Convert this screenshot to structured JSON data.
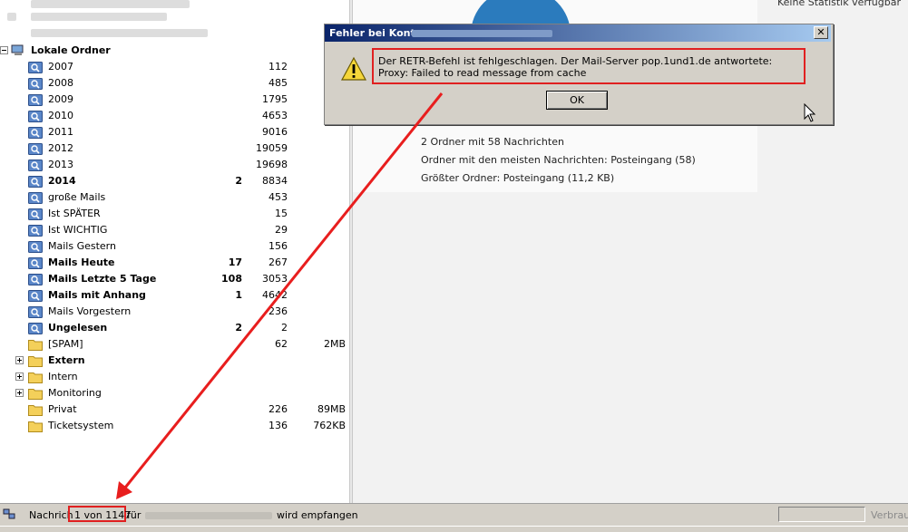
{
  "folders": {
    "account_label": "Lokale Ordner",
    "items": [
      {
        "name": "2007",
        "unread": "",
        "total": "112",
        "size": "",
        "type": "search",
        "bold": false,
        "expandable": false
      },
      {
        "name": "2008",
        "unread": "",
        "total": "485",
        "size": "",
        "type": "search",
        "bold": false,
        "expandable": false
      },
      {
        "name": "2009",
        "unread": "",
        "total": "1795",
        "size": "",
        "type": "search",
        "bold": false,
        "expandable": false
      },
      {
        "name": "2010",
        "unread": "",
        "total": "4653",
        "size": "",
        "type": "search",
        "bold": false,
        "expandable": false
      },
      {
        "name": "2011",
        "unread": "",
        "total": "9016",
        "size": "",
        "type": "search",
        "bold": false,
        "expandable": false
      },
      {
        "name": "2012",
        "unread": "",
        "total": "19059",
        "size": "",
        "type": "search",
        "bold": false,
        "expandable": false
      },
      {
        "name": "2013",
        "unread": "",
        "total": "19698",
        "size": "",
        "type": "search",
        "bold": false,
        "expandable": false
      },
      {
        "name": "2014",
        "unread": "2",
        "total": "8834",
        "size": "",
        "type": "search",
        "bold": true,
        "expandable": false
      },
      {
        "name": "große Mails",
        "unread": "",
        "total": "453",
        "size": "",
        "type": "search",
        "bold": false,
        "expandable": false
      },
      {
        "name": "Ist SPÄTER",
        "unread": "",
        "total": "15",
        "size": "",
        "type": "search",
        "bold": false,
        "expandable": false
      },
      {
        "name": "Ist WICHTIG",
        "unread": "",
        "total": "29",
        "size": "",
        "type": "search",
        "bold": false,
        "expandable": false
      },
      {
        "name": "Mails Gestern",
        "unread": "",
        "total": "156",
        "size": "",
        "type": "search",
        "bold": false,
        "expandable": false
      },
      {
        "name": "Mails Heute",
        "unread": "17",
        "total": "267",
        "size": "",
        "type": "search",
        "bold": true,
        "expandable": false
      },
      {
        "name": "Mails Letzte 5 Tage",
        "unread": "108",
        "total": "3053",
        "size": "",
        "type": "search",
        "bold": true,
        "expandable": false
      },
      {
        "name": "Mails mit Anhang",
        "unread": "1",
        "total": "4642",
        "size": "",
        "type": "search",
        "bold": true,
        "expandable": false
      },
      {
        "name": "Mails Vorgestern",
        "unread": "",
        "total": "236",
        "size": "",
        "type": "search",
        "bold": false,
        "expandable": false
      },
      {
        "name": "Ungelesen",
        "unread": "2",
        "total": "2",
        "size": "",
        "type": "search",
        "bold": true,
        "expandable": false
      },
      {
        "name": "[SPAM]",
        "unread": "",
        "total": "62",
        "size": "2MB",
        "type": "folder",
        "bold": false,
        "expandable": false
      },
      {
        "name": "Extern",
        "unread": "",
        "total": "",
        "size": "",
        "type": "folder",
        "bold": true,
        "expandable": true
      },
      {
        "name": "Intern",
        "unread": "",
        "total": "",
        "size": "",
        "type": "folder",
        "bold": false,
        "expandable": true
      },
      {
        "name": "Monitoring",
        "unread": "",
        "total": "",
        "size": "",
        "type": "folder",
        "bold": false,
        "expandable": true
      },
      {
        "name": "Privat",
        "unread": "",
        "total": "226",
        "size": "89MB",
        "type": "folder",
        "bold": false,
        "expandable": false
      },
      {
        "name": "Ticketsystem",
        "unread": "",
        "total": "136",
        "size": "762KB",
        "type": "folder",
        "bold": false,
        "expandable": false
      }
    ]
  },
  "summary": {
    "top_right": "Keine Statistik verfügbar",
    "line1": "2 Ordner mit 58 Nachrichten",
    "line2": "Ordner mit den meisten Nachrichten: Posteingang (58)",
    "line3": "Größter Ordner: Posteingang (11,2 KB)"
  },
  "dialog": {
    "title": "Fehler bei Konto",
    "message": "Der RETR-Befehl ist fehlgeschlagen. Der Mail-Server pop.1und1.de antwortete: Proxy: Failed to read message from cache",
    "ok_label": "OK",
    "close_glyph": "✕"
  },
  "status": {
    "prefix": "Nachrich",
    "count": "1 von 1147",
    "fuer": "für",
    "suffix": "wird empfangen",
    "connection": "Verbrau"
  },
  "colors": {
    "highlight": "#e02020",
    "titlebar": "#0a246a",
    "search_folder": "#5a86c8",
    "folder": "#f4d05a"
  }
}
